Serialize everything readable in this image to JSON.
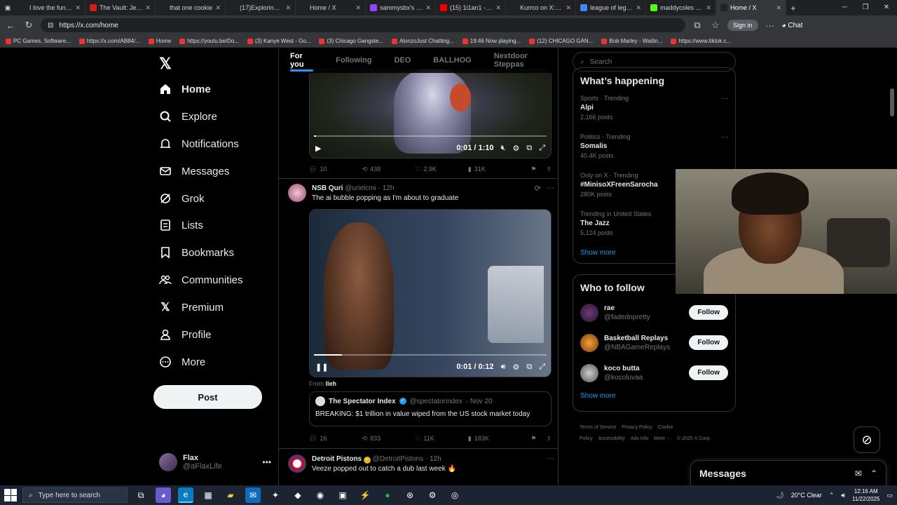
{
  "browser": {
    "tabs": [
      {
        "title": "I love the funk in",
        "color": "#222"
      },
      {
        "title": "The Vault: Jet Li",
        "color": "#c21"
      },
      {
        "title": "that one cookie",
        "color": "#222"
      },
      {
        "title": "(17)Exploring Lo",
        "color": "#222"
      },
      {
        "title": "Home / X",
        "color": "#222"
      },
      {
        "title": "sammysbx's prof",
        "color": "#9146ff"
      },
      {
        "title": "(15) 1i1an1 - Sw",
        "color": "#e00"
      },
      {
        "title": "Kurrco on X: \"Ki",
        "color": "#222"
      },
      {
        "title": "league of legend",
        "color": "#4285f4"
      },
      {
        "title": "maddycoles Stre",
        "color": "#53fc18"
      },
      {
        "title": "Home / X",
        "color": "#222",
        "active": true
      }
    ],
    "url": "https://x.com/home",
    "signin": "Sign in",
    "chat": "Chat",
    "bookmarks": [
      "PC Games, Software...",
      "https://x.com/AB84/...",
      "Home",
      "https://youtu.be/Do...",
      "(3) Kanye West - Go...",
      "(3) Chicago Gangste...",
      "AlonzoJust Chatting...",
      "19:46 Now playing...",
      "(12) CHICAGO GAN...",
      "Bob Marley - Waitin...",
      "https://www.tiktok.c..."
    ]
  },
  "nav": {
    "items": [
      "Home",
      "Explore",
      "Notifications",
      "Messages",
      "Grok",
      "Lists",
      "Bookmarks",
      "Communities",
      "Premium",
      "Profile",
      "More"
    ],
    "post": "Post",
    "me_name": "Flax",
    "me_handle": "@aFlaxLife"
  },
  "tabs": [
    "For you",
    "Following",
    "DEO",
    "BALLHOG",
    "Nextdoor Steppas"
  ],
  "tweet1": {
    "time": "0:01 / 1:10",
    "progress": 0.01,
    "replies": "10",
    "reposts": "438",
    "likes": "2.9K",
    "views": "31K"
  },
  "tweet2": {
    "name": "NSB Quri",
    "handle": "@urielcmi",
    "age": "· 12h",
    "text": "The ai bubble popping as I'm about to graduate",
    "time": "0:01 / 0:12",
    "progress": 0.12,
    "from_label": "From",
    "from_name": "lleh",
    "quote_name": "The Spectator Index",
    "quote_handle": "@spectatorindex",
    "quote_date": "· Nov 20",
    "quote_text": "BREAKING: $1 trillion in value wiped from the US stock market today",
    "replies": "16",
    "reposts": "833",
    "likes": "11K",
    "views": "183K"
  },
  "tweet3": {
    "name": "Detroit Pistons",
    "handle": "@DetroitPistons",
    "age": "· 12h",
    "text": "Veeze popped out to catch a dub last week 🔥"
  },
  "right": {
    "search_placeholder": "Search",
    "happening_title": "What’s happening",
    "trends": [
      {
        "context": "Sports · Trending",
        "name": "Alpi",
        "count": "2,166 posts"
      },
      {
        "context": "Politics · Trending",
        "name": "Somalis",
        "count": "40.4K posts"
      },
      {
        "context": "Only on X · Trending",
        "name": "#MinisoXFreenSarocha",
        "count": "280K posts"
      },
      {
        "context": "Trending in United States",
        "name": "The Jazz",
        "count": "5,124 posts"
      }
    ],
    "show_more": "Show more",
    "who_title": "Who to follow",
    "follow": [
      {
        "name": "rae",
        "handle": "@fadednpretty"
      },
      {
        "name": "Basketball Replays",
        "handle": "@NBAGameReplays"
      },
      {
        "name": "koco butta",
        "handle": "@kocoluvaa"
      }
    ],
    "follow_label": "Follow",
    "footer": [
      "Terms of Service",
      "Privacy Policy",
      "Cookie Policy",
      "Accessibility",
      "Ads info",
      "More ···",
      "© 2025 X Corp."
    ]
  },
  "messages_label": "Messages",
  "taskbar": {
    "search": "Type here to search",
    "weather": "20°C  Clear",
    "time": "12:16 AM",
    "date": "11/22/2025"
  }
}
